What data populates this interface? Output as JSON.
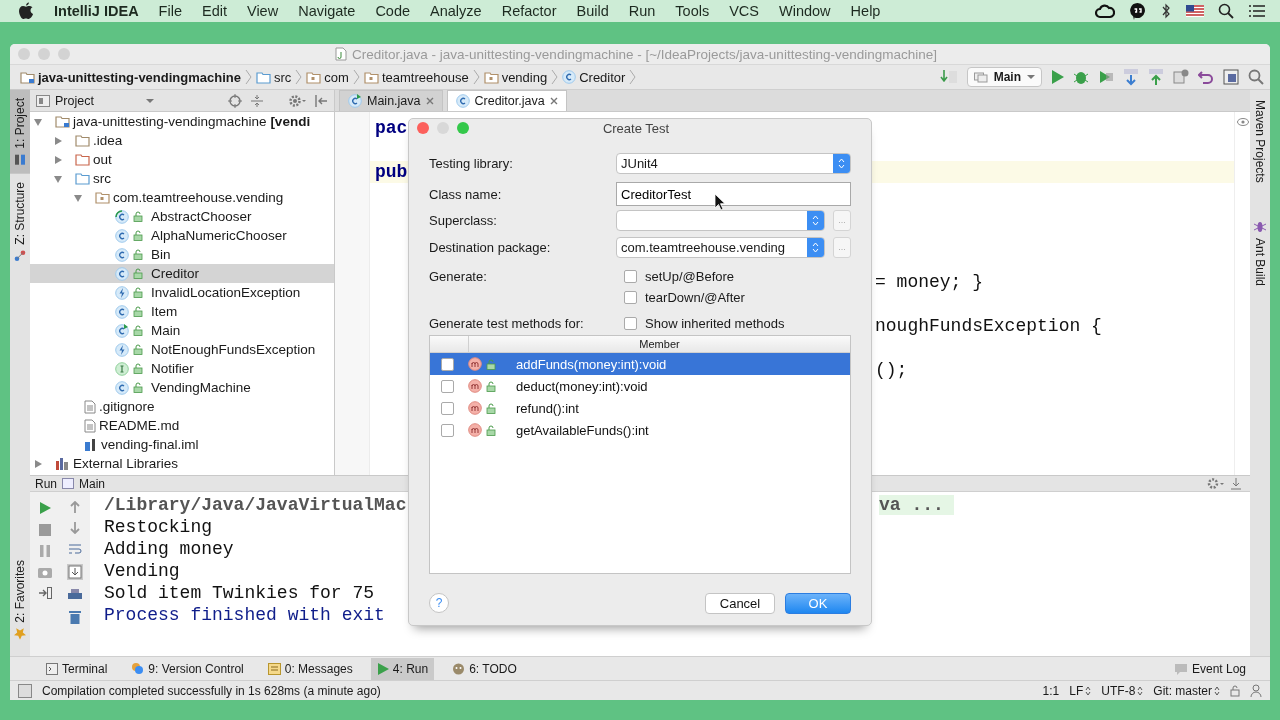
{
  "menubar": {
    "app": "IntelliJ IDEA",
    "menus": [
      "File",
      "Edit",
      "View",
      "Navigate",
      "Code",
      "Analyze",
      "Refactor",
      "Build",
      "Run",
      "Tools",
      "VCS",
      "Window",
      "Help"
    ]
  },
  "window": {
    "title": "Creditor.java - java-unittesting-vendingmachine - [~/IdeaProjects/java-unittesting-vendingmachine]"
  },
  "breadcrumbs": [
    {
      "label": "java-unittesting-vendingmachine",
      "kind": "project"
    },
    {
      "label": "src",
      "kind": "source"
    },
    {
      "label": "com",
      "kind": "package"
    },
    {
      "label": "teamtreehouse",
      "kind": "package"
    },
    {
      "label": "vending",
      "kind": "package"
    },
    {
      "label": "Creditor",
      "kind": "class"
    }
  ],
  "run_config": "Main",
  "left_strip": [
    {
      "label": "1: Project",
      "selected": true
    },
    {
      "label": "Z: Structure",
      "selected": false
    }
  ],
  "left_strip_bottom": [
    {
      "label": "2: Favorites",
      "selected": false
    }
  ],
  "right_strip": [
    {
      "label": "Maven Projects",
      "kind": "maven"
    },
    {
      "label": "Ant Build",
      "kind": "ant"
    }
  ],
  "project_panel": {
    "title": "Project",
    "tree": [
      {
        "label": "java-unittesting-vendingmachine **[vendi**",
        "kind": "project",
        "expanded": true,
        "selected": false,
        "children": [
          {
            "label": ".idea",
            "kind": "folder",
            "expanded": false,
            "selected": false
          },
          {
            "label": "out",
            "kind": "excluded",
            "expanded": false,
            "selected": false
          },
          {
            "label": "src",
            "kind": "source",
            "expanded": true,
            "selected": false,
            "children": [
              {
                "label": "com.teamtreehouse.vending",
                "kind": "package",
                "expanded": true,
                "selected": false,
                "children": [
                  {
                    "label": "AbstractChooser",
                    "kind": "abstract",
                    "selected": false
                  },
                  {
                    "label": "AlphaNumericChooser",
                    "kind": "class",
                    "selected": false
                  },
                  {
                    "label": "Bin",
                    "kind": "class",
                    "selected": false
                  },
                  {
                    "label": "Creditor",
                    "kind": "class",
                    "selected": true
                  },
                  {
                    "label": "InvalidLocationException",
                    "kind": "exception",
                    "selected": false
                  },
                  {
                    "label": "Item",
                    "kind": "class",
                    "selected": false
                  },
                  {
                    "label": "Main",
                    "kind": "main",
                    "selected": false
                  },
                  {
                    "label": "NotEnoughFundsException",
                    "kind": "exception",
                    "selected": false
                  },
                  {
                    "label": "Notifier",
                    "kind": "interface",
                    "selected": false
                  },
                  {
                    "label": "VendingMachine",
                    "kind": "class",
                    "selected": false
                  }
                ]
              }
            ]
          },
          {
            "label": ".gitignore",
            "kind": "file",
            "selected": false
          },
          {
            "label": "README.md",
            "kind": "file",
            "selected": false
          },
          {
            "label": "vending-final.iml",
            "kind": "module",
            "selected": false
          }
        ]
      },
      {
        "label": "External Libraries",
        "kind": "library",
        "expanded": false,
        "selected": false
      }
    ]
  },
  "editor": {
    "tabs": [
      {
        "label": "Main.java",
        "kind": "main",
        "selected": false
      },
      {
        "label": "Creditor.java",
        "kind": "class",
        "selected": true
      }
    ],
    "lines": [
      {
        "left": "pac",
        "highlighted": false
      },
      {
        "highlighted": false
      },
      {
        "left": "pub",
        "highlighted": true
      },
      {
        "highlighted": false
      },
      {
        "highlighted": false
      },
      {
        "highlighted": false
      },
      {
        "highlighted": false
      },
      {
        "right": "= money; }",
        "highlighted": false
      },
      {
        "highlighted": false
      },
      {
        "right": "noughFundsException {",
        "highlighted": false
      },
      {
        "highlighted": false
      },
      {
        "right": "();",
        "highlighted": false
      }
    ]
  },
  "run_panel": {
    "title": "Run",
    "tab": "Main",
    "lines": [
      {
        "kind": "command",
        "left": "/Library/Java/JavaVirtualMac",
        "right": "va ..."
      },
      {
        "kind": "output",
        "left": "Restocking"
      },
      {
        "kind": "output",
        "left": "Adding money"
      },
      {
        "kind": "output",
        "left": "Vending"
      },
      {
        "kind": "output",
        "left": "Sold item Twinkies for 75"
      },
      {
        "kind": "exit",
        "left": "Process finished with exit"
      }
    ]
  },
  "tool_windows": [
    {
      "label": "Terminal",
      "kind": "terminal",
      "selected": false
    },
    {
      "label": "9: Version Control",
      "kind": "vcs",
      "selected": false
    },
    {
      "label": "0: Messages",
      "kind": "messages",
      "selected": false
    },
    {
      "label": "4: Run",
      "kind": "run",
      "selected": true
    },
    {
      "label": "6: TODO",
      "kind": "todo",
      "selected": false
    }
  ],
  "event_log": "Event Log",
  "status_bar": {
    "message": "Compilation completed successfully in 1s 628ms (a minute ago)",
    "position": "1:1",
    "line_separator": "LF",
    "encoding": "UTF-8",
    "vcs_branch": "Git: master"
  },
  "dialog": {
    "title": "Create Test",
    "fields": [
      {
        "label": "Testing library:",
        "kind": "select",
        "value": "JUnit4"
      },
      {
        "label": "Class name:",
        "kind": "input",
        "value": "CreditorTest"
      },
      {
        "label": "Superclass:",
        "kind": "browse",
        "browse": "..."
      },
      {
        "label": "Destination package:",
        "kind": "browse",
        "value": "com.teamtreehouse.vending",
        "browse": "..."
      }
    ],
    "generate": {
      "label": "Generate:",
      "options": [
        {
          "label": "setUp/@Before",
          "checked": false
        },
        {
          "label": "tearDown/@After",
          "checked": false
        }
      ]
    },
    "methods": {
      "label": "Generate test methods for:",
      "show_inherited": {
        "label": "Show inherited methods",
        "checked": false
      },
      "column": "Member",
      "rows": [
        {
          "name": "addFunds(money:int):void",
          "checked": false,
          "selected": true
        },
        {
          "name": "deduct(money:int):void",
          "checked": false,
          "selected": false
        },
        {
          "name": "refund():int",
          "checked": false,
          "selected": false
        },
        {
          "name": "getAvailableFunds():int",
          "checked": false,
          "selected": false
        }
      ]
    },
    "help": "?",
    "buttons": [
      {
        "label": "Cancel",
        "kind": "default"
      },
      {
        "label": "OK",
        "kind": "primary"
      }
    ]
  }
}
